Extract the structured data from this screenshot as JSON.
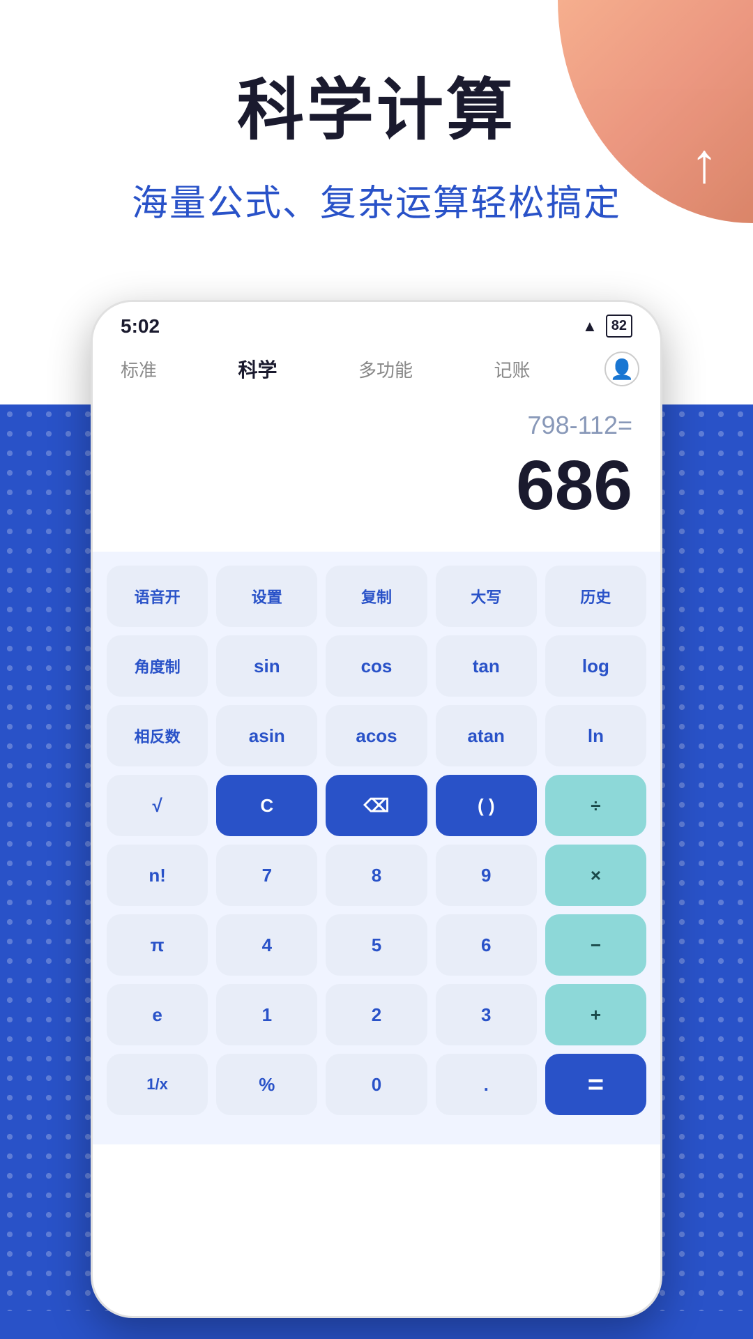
{
  "header": {
    "title": "科学计算",
    "subtitle": "海量公式、复杂运算轻松搞定"
  },
  "status_bar": {
    "time": "5:02",
    "battery": "82"
  },
  "nav": {
    "tabs": [
      {
        "label": "标准",
        "active": false
      },
      {
        "label": "科学",
        "active": true
      },
      {
        "label": "多功能",
        "active": false
      },
      {
        "label": "记账",
        "active": false
      }
    ]
  },
  "display": {
    "expression": "798-112=",
    "result": "686"
  },
  "keypad": {
    "rows": [
      [
        {
          "label": "语音开",
          "type": "light"
        },
        {
          "label": "设置",
          "type": "light"
        },
        {
          "label": "复制",
          "type": "light"
        },
        {
          "label": "大写",
          "type": "light"
        },
        {
          "label": "历史",
          "type": "light"
        }
      ],
      [
        {
          "label": "角度制",
          "type": "light"
        },
        {
          "label": "sin",
          "type": "light"
        },
        {
          "label": "cos",
          "type": "light"
        },
        {
          "label": "tan",
          "type": "light"
        },
        {
          "label": "log",
          "type": "light"
        }
      ],
      [
        {
          "label": "相反数",
          "type": "light"
        },
        {
          "label": "asin",
          "type": "light"
        },
        {
          "label": "acos",
          "type": "light"
        },
        {
          "label": "atan",
          "type": "light"
        },
        {
          "label": "ln",
          "type": "light"
        }
      ],
      [
        {
          "label": "√",
          "type": "light"
        },
        {
          "label": "C",
          "type": "dark-blue"
        },
        {
          "label": "⌫",
          "type": "dark-blue"
        },
        {
          "label": "( )",
          "type": "dark-blue"
        },
        {
          "label": "÷",
          "type": "teal"
        }
      ],
      [
        {
          "label": "n!",
          "type": "light"
        },
        {
          "label": "7",
          "type": "light"
        },
        {
          "label": "8",
          "type": "light"
        },
        {
          "label": "9",
          "type": "light"
        },
        {
          "label": "×",
          "type": "teal"
        }
      ],
      [
        {
          "label": "π",
          "type": "light"
        },
        {
          "label": "4",
          "type": "light"
        },
        {
          "label": "5",
          "type": "light"
        },
        {
          "label": "6",
          "type": "light"
        },
        {
          "label": "−",
          "type": "teal"
        }
      ],
      [
        {
          "label": "e",
          "type": "light"
        },
        {
          "label": "1",
          "type": "light"
        },
        {
          "label": "2",
          "type": "light"
        },
        {
          "label": "3",
          "type": "light"
        },
        {
          "label": "+",
          "type": "teal"
        }
      ],
      [
        {
          "label": "1/x",
          "type": "light"
        },
        {
          "label": "%",
          "type": "light"
        },
        {
          "label": "0",
          "type": "light"
        },
        {
          "label": ".",
          "type": "light"
        },
        {
          "label": "=",
          "type": "equals"
        }
      ]
    ]
  }
}
